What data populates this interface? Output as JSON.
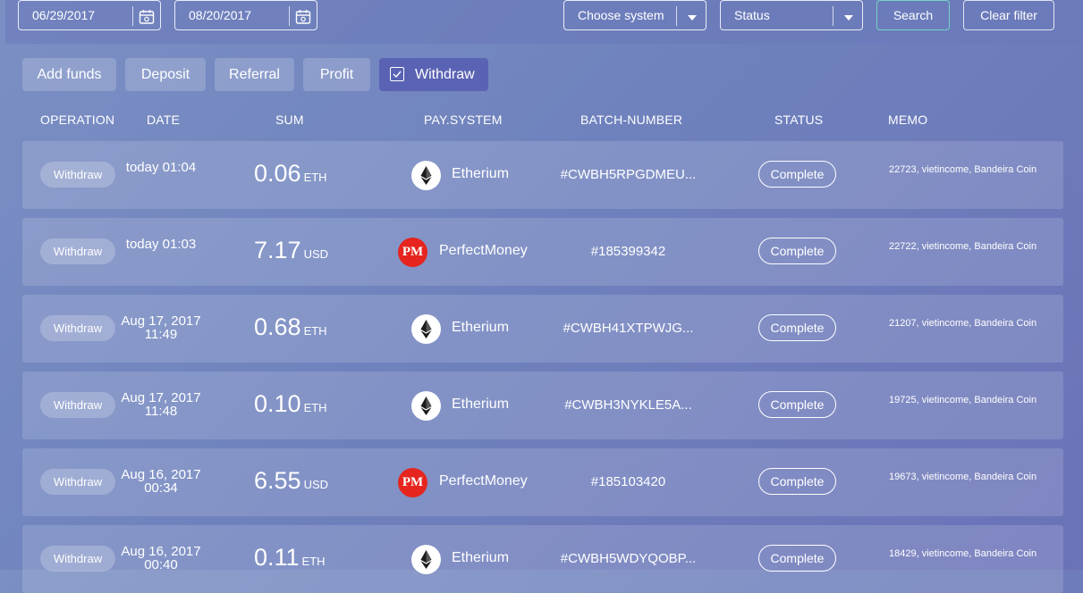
{
  "filters": {
    "date_from": "06/29/2017",
    "date_to": "08/20/2017",
    "system_label": "Choose system",
    "status_label": "Status",
    "search_label": "Search",
    "clear_label": "Clear filter"
  },
  "tabs": [
    {
      "label": "Add funds",
      "active": false
    },
    {
      "label": "Deposit",
      "active": false
    },
    {
      "label": "Referral",
      "active": false
    },
    {
      "label": "Profit",
      "active": false
    },
    {
      "label": "Withdraw",
      "active": true
    }
  ],
  "columns": [
    "OPERATION",
    "DATE",
    "SUM",
    "PAY.SYSTEM",
    "BATCH-NUMBER",
    "STATUS",
    "MEMO"
  ],
  "rows": [
    {
      "operation": "Withdraw",
      "date": "today 01:04",
      "time": "",
      "amount": "0.06",
      "currency": "ETH",
      "system": "Etherium",
      "batch": "#CWBH5RPGDMEU...",
      "status": "Complete",
      "memo": "22723, vietincome, Bandeira Coin"
    },
    {
      "operation": "Withdraw",
      "date": "today 01:03",
      "time": "",
      "amount": "7.17",
      "currency": "USD",
      "system": "PerfectMoney",
      "batch": "#185399342",
      "status": "Complete",
      "memo": "22722, vietincome, Bandeira Coin"
    },
    {
      "operation": "Withdraw",
      "date": "Aug 17, 2017",
      "time": "11:49",
      "amount": "0.68",
      "currency": "ETH",
      "system": "Etherium",
      "batch": "#CWBH41XTPWJG...",
      "status": "Complete",
      "memo": "21207, vietincome, Bandeira Coin"
    },
    {
      "operation": "Withdraw",
      "date": "Aug 17, 2017",
      "time": "11:48",
      "amount": "0.10",
      "currency": "ETH",
      "system": "Etherium",
      "batch": "#CWBH3NYKLE5A...",
      "status": "Complete",
      "memo": "19725, vietincome, Bandeira Coin"
    },
    {
      "operation": "Withdraw",
      "date": "Aug 16, 2017",
      "time": "00:34",
      "amount": "6.55",
      "currency": "USD",
      "system": "PerfectMoney",
      "batch": "#185103420",
      "status": "Complete",
      "memo": "19673, vietincome, Bandeira Coin"
    },
    {
      "operation": "Withdraw",
      "date": "Aug 16, 2017",
      "time": "00:40",
      "amount": "0.11",
      "currency": "ETH",
      "system": "Etherium",
      "batch": "#CWBH5WDYQOBP...",
      "status": "Complete",
      "memo": "18429, vietincome, Bandeira Coin"
    }
  ],
  "icons": {
    "calendar": "calendar-icon",
    "dropdown": "chevron-down-icon",
    "check": "checkbox-checked-icon",
    "ethereum": "ethereum-icon",
    "perfectmoney": "perfectmoney-icon",
    "perfectmoney_text": "PM"
  },
  "colors": {
    "background": "#7485c0",
    "active_tab": "#5a63b3",
    "perfectmoney_red": "#e5251e"
  }
}
